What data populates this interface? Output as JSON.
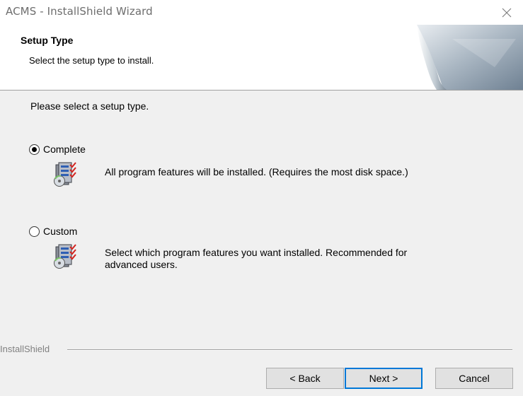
{
  "window": {
    "title": "ACMS - InstallShield Wizard",
    "close_icon": "close-icon"
  },
  "header": {
    "title": "Setup Type",
    "subtitle": "Select the setup type to install.",
    "art_icon": "wizard-page-curl-graphic"
  },
  "main": {
    "prompt": "Please select a setup type.",
    "options": [
      {
        "label": "Complete",
        "selected": true,
        "icon": "install-package-icon",
        "description": [
          "All program features will be installed. (Requires the most disk space.)"
        ]
      },
      {
        "label": "Custom",
        "selected": false,
        "icon": "install-package-icon",
        "description": [
          "Select which program features you want installed. Recommended for",
          "advanced users."
        ]
      }
    ]
  },
  "footer": {
    "brand": "InstallShield",
    "back_label": "< Back",
    "next_label": "Next >",
    "cancel_label": "Cancel"
  },
  "colors": {
    "title_text": "#6d6d6d",
    "dialog_bg": "#f0f0f0",
    "header_bg": "#ffffff",
    "default_button_border": "#0078d7"
  }
}
